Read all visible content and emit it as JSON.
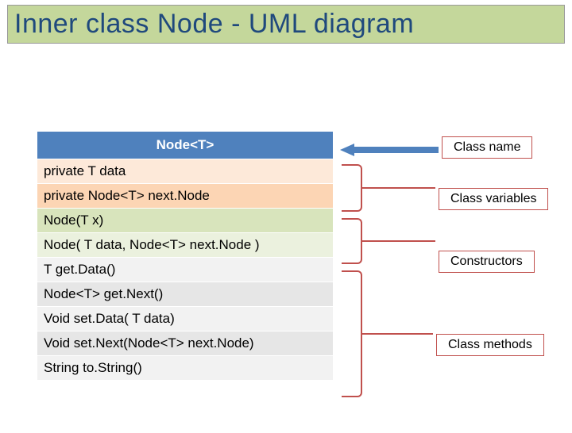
{
  "title": "Inner class Node - UML diagram",
  "uml": {
    "class_name": "Node<T>",
    "variables": [
      "private T  data",
      "private Node<T>  next.Node"
    ],
    "constructors": [
      "Node(T x)",
      "Node( T data, Node<T>  next.Node )"
    ],
    "methods": [
      "T  get.Data()",
      "Node<T>  get.Next()",
      "Void  set.Data( T data)",
      "Void  set.Next(Node<T>  next.Node)",
      "String   to.String()"
    ]
  },
  "labels": {
    "class_name": "Class name",
    "class_variables": "Class variables",
    "constructors": "Constructors",
    "class_methods": "Class methods"
  }
}
